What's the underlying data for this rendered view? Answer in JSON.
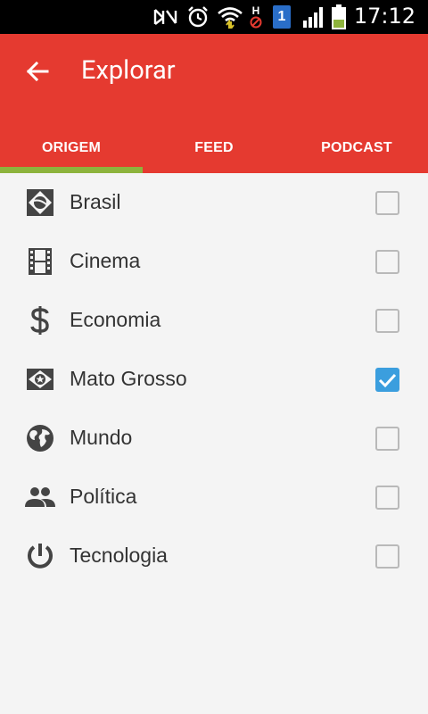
{
  "status_bar": {
    "time": "17:12",
    "icons": [
      "nfc-icon",
      "alarm-icon",
      "wifi-icon",
      "h-signal-icon",
      "notification-1-icon",
      "signal-icon",
      "battery-icon"
    ],
    "badge_number": "1",
    "h_label": "H"
  },
  "app_bar": {
    "title": "Explorar",
    "back_icon": "arrow-left-icon",
    "color": "#e53a30"
  },
  "tabs": [
    {
      "label": "ORIGEM",
      "selected": true
    },
    {
      "label": "FEED",
      "selected": false
    },
    {
      "label": "PODCAST",
      "selected": false
    }
  ],
  "tab_indicator_color": "#8db33c",
  "items": [
    {
      "label": "Brasil",
      "icon": "brazil-flag-icon",
      "checked": false
    },
    {
      "label": "Cinema",
      "icon": "film-icon",
      "checked": false
    },
    {
      "label": "Economia",
      "icon": "dollar-icon",
      "checked": false
    },
    {
      "label": "Mato Grosso",
      "icon": "mato-grosso-flag-icon",
      "checked": true
    },
    {
      "label": "Mundo",
      "icon": "globe-icon",
      "checked": false
    },
    {
      "label": "Política",
      "icon": "people-icon",
      "checked": false
    },
    {
      "label": "Tecnologia",
      "icon": "power-icon",
      "checked": false
    }
  ],
  "checkbox_color": "#3b9ede"
}
